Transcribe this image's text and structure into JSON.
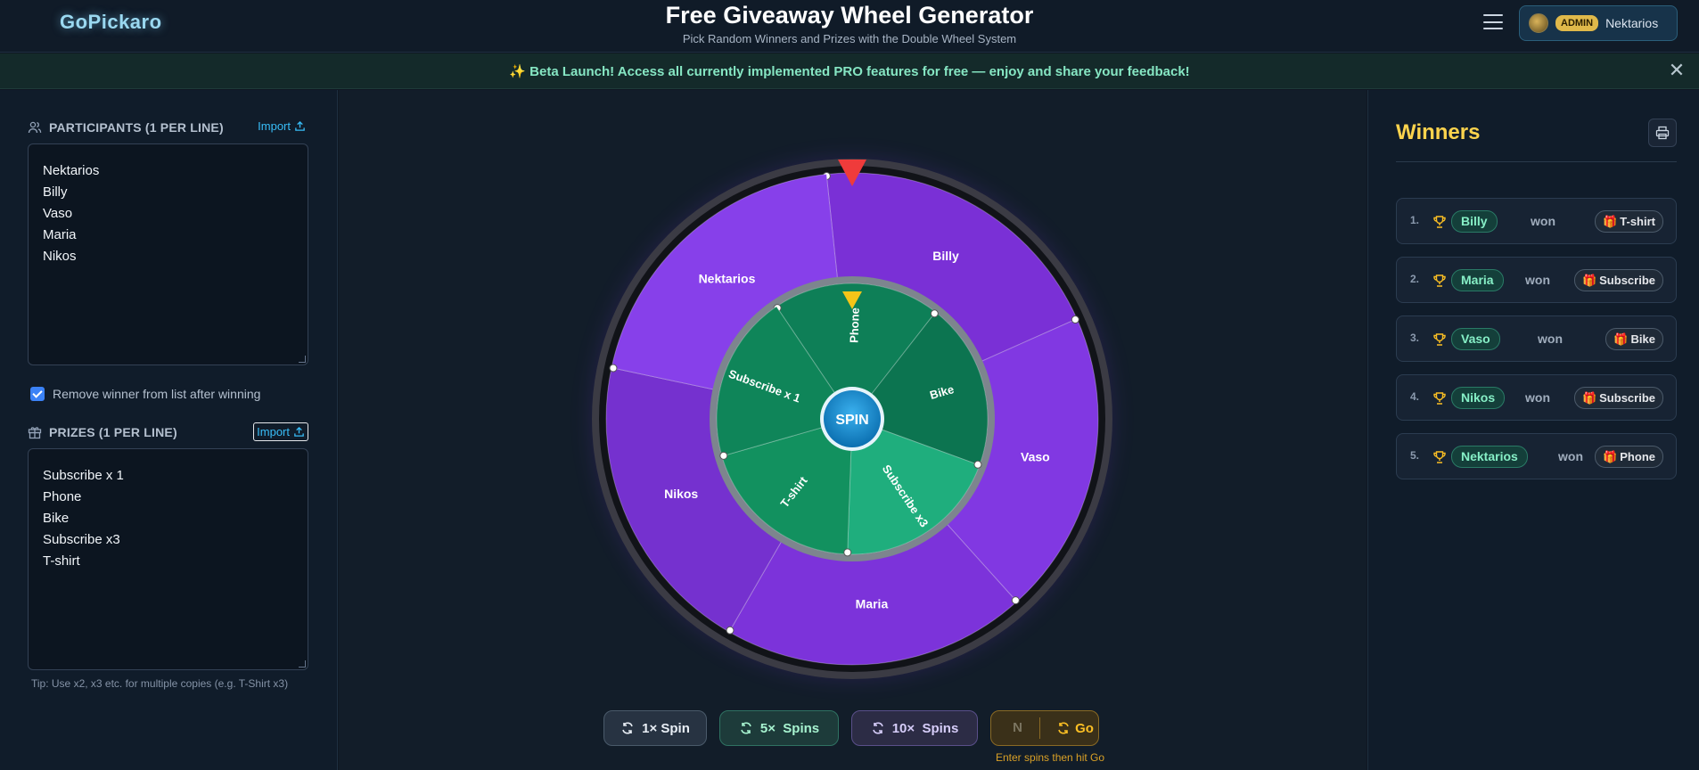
{
  "header": {
    "logo": "GoPickaro",
    "title": "Free Giveaway Wheel Generator",
    "subtitle": "Pick Random Winners and Prizes with the Double Wheel System",
    "user": {
      "role_badge": "ADMIN",
      "name": "Nektarios"
    }
  },
  "banner": {
    "text": "✨ Beta Launch! Access all currently implemented PRO features for free — enjoy and share your feedback!"
  },
  "participants": {
    "label": "PARTICIPANTS (1 PER LINE)",
    "import_label": "Import",
    "items": [
      "Nektarios",
      "Billy",
      "Vaso",
      "Maria",
      "Nikos"
    ]
  },
  "remove_winner": {
    "label": "Remove winner from list after winning",
    "checked": true
  },
  "prizes": {
    "label": "PRIZES (1 PER LINE)",
    "import_label": "Import",
    "items": [
      "Subscribe x 1",
      "Phone",
      "Bike",
      "Subscribe x3",
      "T-shirt"
    ],
    "tip": "Tip: Use x2, x3 etc. for multiple copies (e.g. T-Shirt x3)"
  },
  "wheel": {
    "spin_label": "SPIN",
    "outer_segments": [
      "Billy",
      "Vaso",
      "Maria",
      "Nikos",
      "Nektarios"
    ],
    "inner_segments": [
      "Phone",
      "Bike",
      "Subscribe x3",
      "T-shirt",
      "Subscribe x 1"
    ],
    "colors": {
      "outer": "#7e34de",
      "inner": "#0f8a5f",
      "outer_pointer": "#ef3b3b",
      "inner_pointer": "#f5c518"
    }
  },
  "spin_controls": {
    "one": "1× Spin",
    "five": "5×  Spins",
    "ten": "10×  Spins",
    "custom_placeholder": "N",
    "go": "Go",
    "hint": "Enter spins then hit Go"
  },
  "winners": {
    "title": "Winners",
    "won_word": "won",
    "rows": [
      {
        "num": "1.",
        "name": "Billy",
        "prize": "T-shirt"
      },
      {
        "num": "2.",
        "name": "Maria",
        "prize": "Subscribe"
      },
      {
        "num": "3.",
        "name": "Vaso",
        "prize": "Bike"
      },
      {
        "num": "4.",
        "name": "Nikos",
        "prize": "Subscribe"
      },
      {
        "num": "5.",
        "name": "Nektarios",
        "prize": "Phone"
      }
    ]
  }
}
